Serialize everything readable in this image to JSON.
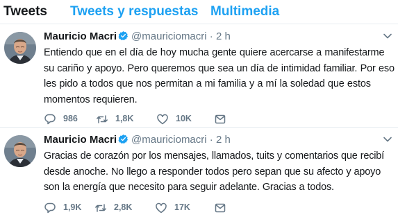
{
  "tabs": [
    {
      "label": "Tweets",
      "active": true
    },
    {
      "label": "Tweets y respuestas",
      "active": false
    },
    {
      "label": "Multimedia",
      "active": false
    }
  ],
  "colors": {
    "accent": "#1da1f2",
    "secondary_text": "#657786",
    "primary_text": "#14171a",
    "divider": "#e6ecf0"
  },
  "tweets": [
    {
      "author_name": "Mauricio Macri",
      "verified": true,
      "verified_icon": "verified-badge-icon",
      "handle": "@mauriciomacri",
      "separator": "·",
      "time": "2 h",
      "text": "Entiendo que en el día de hoy mucha gente quiere acercarse a manifestarme su cariño y apoyo. Pero queremos que sea un día de intimidad familiar. Por eso les pido a todos que nos permitan a mi familia y a mí la soledad que estos momentos requieren.",
      "replies": "986",
      "retweets": "1,8K",
      "likes": "10K"
    },
    {
      "author_name": "Mauricio Macri",
      "verified": true,
      "verified_icon": "verified-badge-icon",
      "handle": "@mauriciomacri",
      "separator": "·",
      "time": "2 h",
      "text": "Gracias de corazón por los mensajes, llamados, tuits y comentarios que recibí desde anoche. No llego a responder todos pero sepan que su afecto y apoyo son la energía que necesito para seguir adelante. Gracias a todos.",
      "replies": "1,9K",
      "retweets": "2,8K",
      "likes": "17K"
    }
  ],
  "icons": {
    "reply": "reply-icon",
    "retweet": "retweet-icon",
    "like": "heart-icon",
    "dm": "envelope-icon",
    "more": "chevron-down-icon"
  }
}
